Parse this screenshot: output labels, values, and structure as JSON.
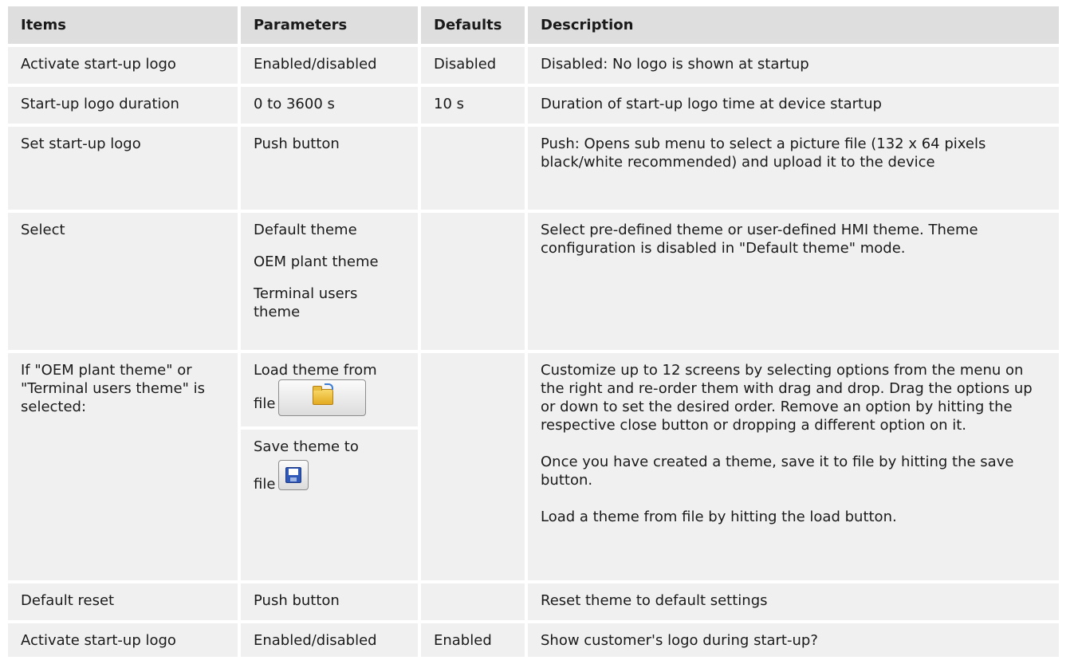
{
  "header": {
    "items": "Items",
    "parameters": "Parameters",
    "defaults": "Defaults",
    "description": "Description"
  },
  "rows": [
    {
      "item": "Activate start-up logo",
      "parameter": "Enabled/disabled",
      "default": "Disabled",
      "description": "Disabled: No logo is shown at startup"
    },
    {
      "item": "Start-up logo duration",
      "parameter": "0 to 3600 s",
      "default": "10 s",
      "description": "Duration of start-up logo time at device startup"
    },
    {
      "item": "Set start-up logo",
      "parameter": "Push button",
      "default": "",
      "description": "Push: Opens sub menu to select a picture file (132 x 64 pixels black/white recommended) and upload it to the device"
    },
    {
      "item": "Select",
      "parameter_options": [
        "Default theme",
        "OEM plant theme",
        "Terminal users theme"
      ],
      "default": "",
      "description": "Select pre-defined theme or user-defined HMI theme. Theme configuration is disabled in \"Default theme\" mode."
    },
    {
      "item": "If \"OEM plant theme\" or \"Terminal users theme\" is selected:",
      "load_label_1": "Load theme from",
      "load_label_2": "file",
      "load_icon": "open-folder-icon",
      "save_label_1": "Save theme to",
      "save_label_2": "file",
      "save_icon": "save-disk-icon",
      "default": "",
      "description_paragraphs": [
        "Customize up to 12 screens by selecting options from the menu on the right and re-order them with drag and drop. Drag the options up or down to set the desired order. Remove an option by hitting the respective close button or dropping a different option on it.",
        "Once you have created a theme, save it to file by hitting the save button.",
        "Load a theme from file by hitting the load button."
      ]
    },
    {
      "item": "Default reset",
      "parameter": "Push button",
      "default": "",
      "description": "Reset theme to default settings"
    },
    {
      "item": "Activate start-up logo",
      "parameter": "Enabled/disabled",
      "default": "Enabled",
      "description": "Show customer's logo during start-up?"
    }
  ],
  "colors": {
    "header_bg": "#dedede",
    "cell_bg": "#f0f0f0",
    "text": "#1a1a1a"
  }
}
